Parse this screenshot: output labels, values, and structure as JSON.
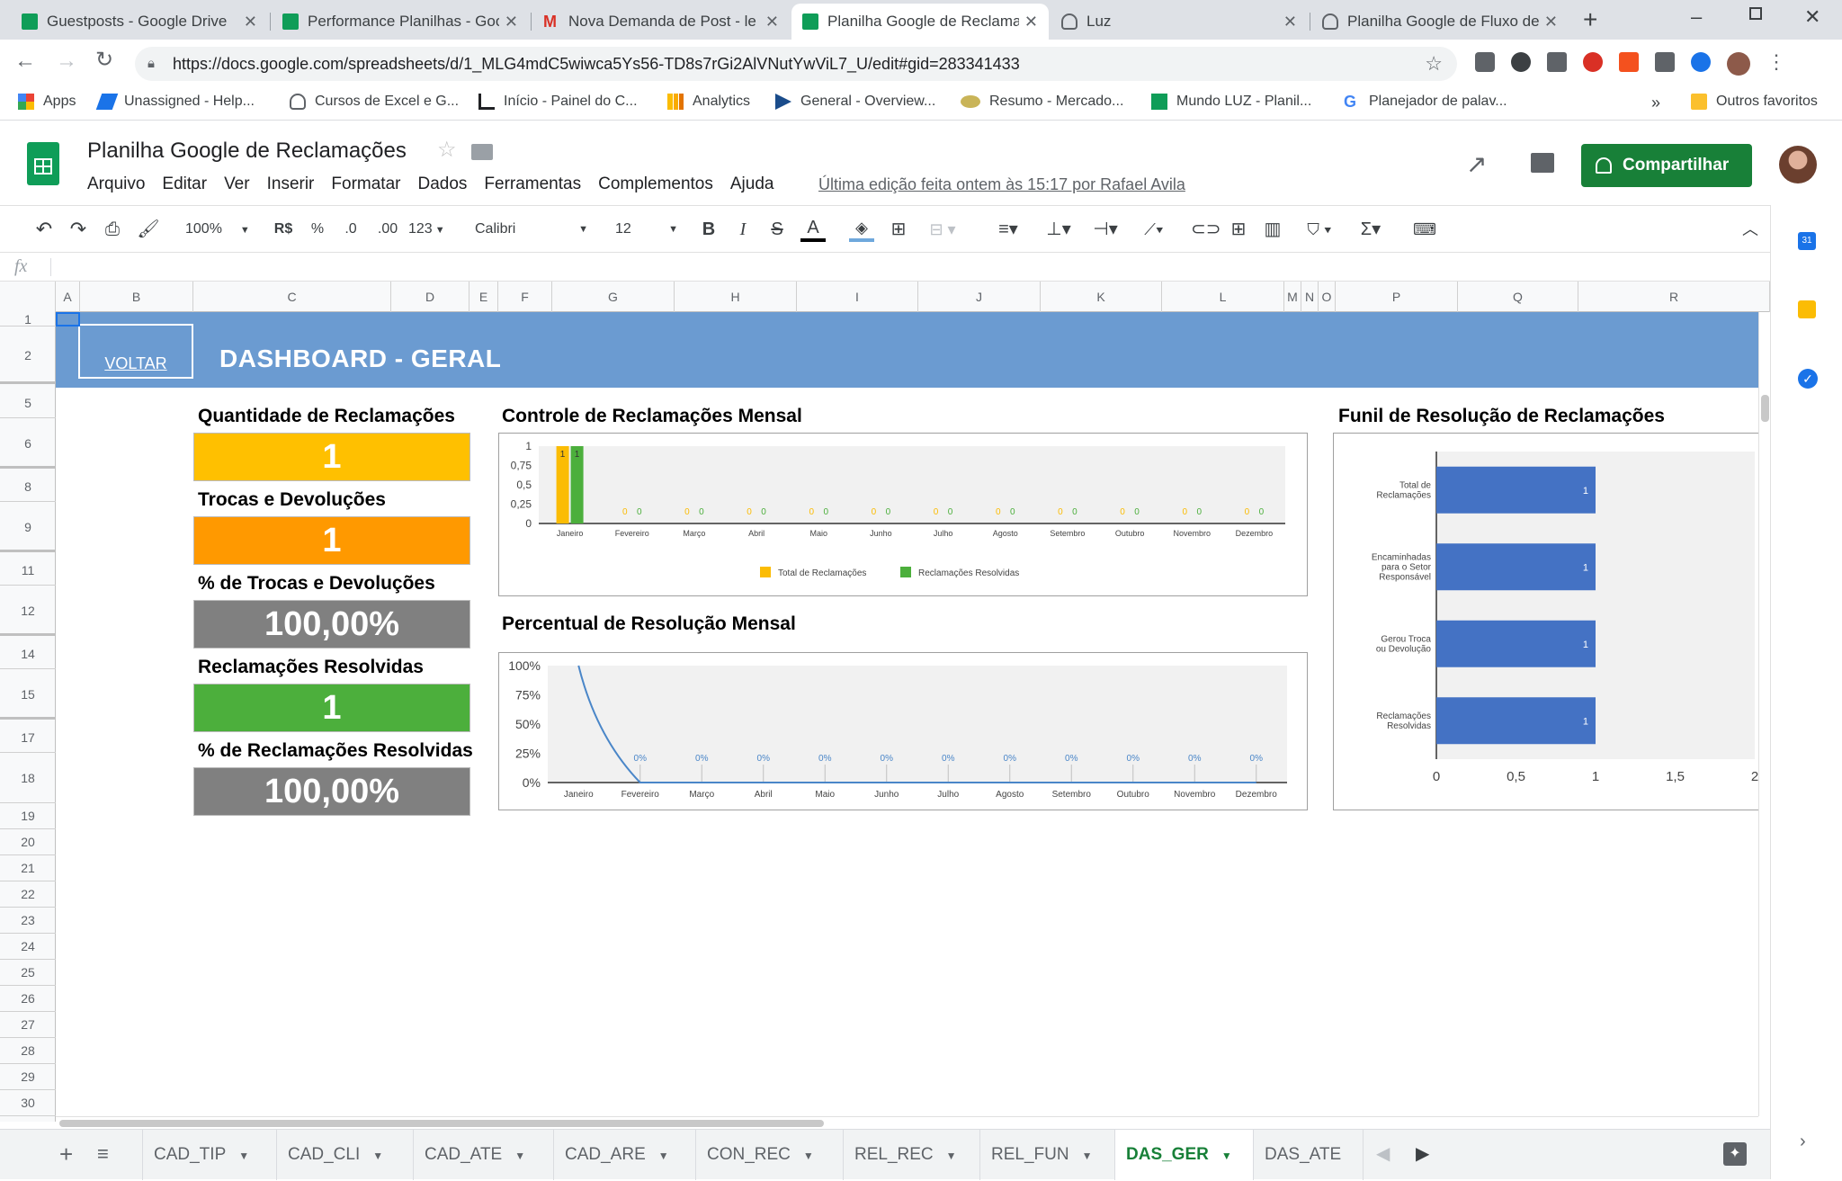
{
  "browser": {
    "tabs": [
      {
        "title": "Guestposts - Google Drive",
        "icon": "sheets"
      },
      {
        "title": "Performance Planilhas - Goo",
        "icon": "sheets"
      },
      {
        "title": "Nova Demanda de Post - le",
        "icon": "gmail"
      },
      {
        "title": "Planilha Google de Reclama",
        "icon": "sheets",
        "active": true
      },
      {
        "title": "Luz",
        "icon": "bulb"
      },
      {
        "title": "Planilha Google de Fluxo de",
        "icon": "bulb"
      }
    ],
    "url": "https://docs.google.com/spreadsheets/d/1_MLG4mdC5wiwca5Ys56-TD8s7rGi2AlVNutYwViL7_U/edit#gid=283341433",
    "bookmarks": [
      "Apps",
      "Unassigned - Help...",
      "Cursos de Excel e G...",
      "Início - Painel do C...",
      "Analytics",
      "General - Overview...",
      "Resumo - Mercado...",
      "Mundo LUZ - Planil...",
      "Planejador de palav..."
    ],
    "other_bookmarks": "Outros favoritos"
  },
  "doc": {
    "title": "Planilha Google de Reclamações",
    "menu": [
      "Arquivo",
      "Editar",
      "Ver",
      "Inserir",
      "Formatar",
      "Dados",
      "Ferramentas",
      "Complementos",
      "Ajuda"
    ],
    "last_edit": "Última edição feita ontem às 15:17 por Rafael Avila",
    "share_label": "Compartilhar"
  },
  "toolbar": {
    "zoom": "100%",
    "currency": "R$",
    "percent": "%",
    "dec_less": ".0",
    "dec_more": ".00",
    "format": "123",
    "font": "Calibri",
    "size": "12"
  },
  "grid": {
    "columns": [
      "A",
      "B",
      "C",
      "D",
      "E",
      "F",
      "G",
      "H",
      "I",
      "J",
      "K",
      "L",
      "M",
      "N",
      "O",
      "P",
      "Q",
      "R"
    ],
    "rows": [
      "1",
      "2",
      "5",
      "6",
      "8",
      "9",
      "11",
      "12",
      "14",
      "15",
      "17",
      "18",
      "19",
      "20",
      "21",
      "22",
      "23",
      "24",
      "25",
      "26",
      "27",
      "28",
      "29",
      "30"
    ]
  },
  "dashboard": {
    "back_label": "VOLTAR",
    "title": "DASHBOARD - GERAL",
    "kpis": [
      {
        "label": "Quantidade de Reclamações",
        "value": "1",
        "color": "#ffc000"
      },
      {
        "label": "Trocas e Devoluções",
        "value": "1",
        "color": "#ff9900"
      },
      {
        "label": "% de Trocas e Devoluções",
        "value": "100,00%",
        "color": "#808080"
      },
      {
        "label": "Reclamações Resolvidas",
        "value": "1",
        "color": "#4caf3c"
      },
      {
        "label": "% de Reclamações Resolvidas",
        "value": "100,00%",
        "color": "#808080"
      }
    ],
    "chart_titles": {
      "monthly": "Controle de Reclamações Mensal",
      "percent": "Percentual de Resolução Mensal",
      "funnel": "Funil de Resolução de Reclamações"
    }
  },
  "chart_data": [
    {
      "type": "bar",
      "title": "Controle de Reclamações Mensal",
      "categories": [
        "Janeiro",
        "Fevereiro",
        "Março",
        "Abril",
        "Maio",
        "Junho",
        "Julho",
        "Agosto",
        "Setembro",
        "Outubro",
        "Novembro",
        "Dezembro"
      ],
      "series": [
        {
          "name": "Total de Reclamações",
          "values": [
            1,
            0,
            0,
            0,
            0,
            0,
            0,
            0,
            0,
            0,
            0,
            0
          ],
          "color": "#fbbc04"
        },
        {
          "name": "Reclamações Resolvidas",
          "values": [
            1,
            0,
            0,
            0,
            0,
            0,
            0,
            0,
            0,
            0,
            0,
            0
          ],
          "color": "#4caf3c"
        }
      ],
      "ylim": [
        0,
        1
      ],
      "yticks": [
        "0",
        "0,25",
        "0,5",
        "0,75",
        "1"
      ],
      "legend": "bottom"
    },
    {
      "type": "line",
      "title": "Percentual de Resolução Mensal",
      "categories": [
        "Janeiro",
        "Fevereiro",
        "Março",
        "Abril",
        "Maio",
        "Junho",
        "Julho",
        "Agosto",
        "Setembro",
        "Outubro",
        "Novembro",
        "Dezembro"
      ],
      "series": [
        {
          "values": [
            100,
            0,
            0,
            0,
            0,
            0,
            0,
            0,
            0,
            0,
            0,
            0
          ],
          "labels": [
            "",
            "0%",
            "0%",
            "0%",
            "0%",
            "0%",
            "0%",
            "0%",
            "0%",
            "0%",
            "0%",
            "0%"
          ],
          "color": "#4a86c8"
        }
      ],
      "ylim": [
        0,
        100
      ],
      "yticks": [
        "0%",
        "25%",
        "50%",
        "75%",
        "100%"
      ]
    },
    {
      "type": "bar",
      "orientation": "horizontal",
      "title": "Funil de Resolução de Reclamações",
      "categories": [
        "Total de Reclamações",
        "Encaminhadas para o Setor Responsável",
        "Gerou Troca ou Devolução",
        "Reclamações Resolvidas"
      ],
      "values": [
        1,
        1,
        1,
        1
      ],
      "color": "#4472c4",
      "xlim": [
        0,
        2
      ],
      "xticks": [
        "0",
        "0,5",
        "1",
        "1,5",
        "2"
      ]
    }
  ],
  "sheet_tabs": [
    "CAD_TIP",
    "CAD_CLI",
    "CAD_ATE",
    "CAD_ARE",
    "CON_REC",
    "REL_REC",
    "REL_FUN",
    "DAS_GER",
    "DAS_ATE"
  ],
  "active_sheet": "DAS_GER"
}
